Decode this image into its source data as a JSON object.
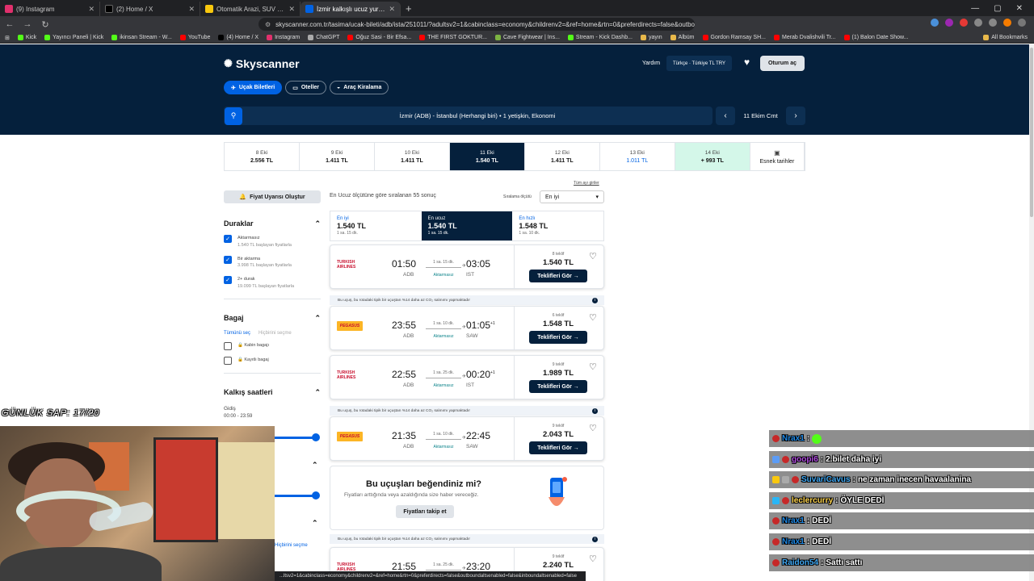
{
  "browser": {
    "tabs": [
      {
        "label": "(9) Instagram",
        "color": "#e1306c"
      },
      {
        "label": "(2) Home / X",
        "color": "#000000"
      },
      {
        "label": "Otomatik Arazi, SUV & Pickup Fiyatl...",
        "color": "#f9c80e"
      },
      {
        "label": "İzmir kalkışlı ucuz yurt içi uçuşlar",
        "color": "#0062e3",
        "active": true
      }
    ],
    "url": "skyscanner.com.tr/tasima/ucak-bileti/adb/ista/251011/?adultsv2=1&cabinclass=economy&childrenv2=&ref=home&rtn=0&preferdirects=false&outbou...",
    "bookmarks": [
      "Kick",
      "Yayıncı Paneli | Kick",
      "ikinsan Stream - W...",
      "YouTube",
      "(4) Home / X",
      "Instagram",
      "ChatGPT",
      "Oğuz Sasi - Bir Efsa...",
      "THE FIRST GOKTUR...",
      "Cave Fightwear | Ins...",
      "Stream - Kick Dashb...",
      "yayın",
      "Albüm",
      "Gordon Ramsay SH...",
      "Merab Dvalishvili Tr...",
      "(1) Balon Date Show..."
    ],
    "all_bookmarks": "All Bookmarks",
    "status_url": "...ltsv2=1&cabinclass=economy&childrenv2=&ref=home&rtn=0&preferdirects=false&outboundaltsenabled=false&inboundaltsenabled=false"
  },
  "header": {
    "logo": "Skyscanner",
    "help": "Yardım",
    "locale": "Türkçe  ·  Türkiye  TL TRY",
    "login": "Oturum aç",
    "pills": [
      "Uçak Biletleri",
      "Oteller",
      "Araç Kiralama"
    ],
    "search_summary": "İzmir (ADB) - İstanbul (Herhangi biri)  •  1 yetişkin, Ekonomi",
    "date": "11 Ekim Cmt"
  },
  "dates": [
    {
      "day": "8 Eki",
      "price": "2.556 TL"
    },
    {
      "day": "9 Eki",
      "price": "1.411 TL"
    },
    {
      "day": "10 Eki",
      "price": "1.411 TL"
    },
    {
      "day": "11 Eki",
      "price": "1.540 TL",
      "selected": true
    },
    {
      "day": "12 Eki",
      "price": "1.411 TL"
    },
    {
      "day": "13 Eki",
      "price": "1.011 TL"
    },
    {
      "day": "14 Eki",
      "price": "+ 993 TL"
    }
  ],
  "flexible_dates": "Esnek tarihler",
  "filters": {
    "alert": "Fiyat Uyarısı Oluştur",
    "stops_title": "Duraklar",
    "stops": [
      {
        "label": "Aktarmasız",
        "sub": "1.540 TL başlayan fiyatlarla"
      },
      {
        "label": "Bir aktarma",
        "sub": "3.998 TL başlayan fiyatlarla"
      },
      {
        "label": "2+ durak",
        "sub": "19.099 TL başlayan fiyatlarla"
      }
    ],
    "baggage_title": "Bagaj",
    "select_all": "Tümünü seç",
    "clear_all": "Hiçbirini seçme",
    "bags": [
      "Kabin bagajı",
      "Kayıtlı bagaj"
    ],
    "times_title": "Kalkış saatleri",
    "outbound": "Gidiş",
    "outbound_range": "00:00 - 23:59",
    "clear_link": "Hiçbirini seçme"
  },
  "results": {
    "count_text": "En Ucuz ölçütüne göre sıralanan 55 sonuç",
    "sort_label": "Sıralama ölçütü",
    "sort_value": "En iyi",
    "all_filters": "Tüm ayı giriler",
    "tabs": [
      {
        "label": "En iyi",
        "price": "1.540 TL",
        "dur": "1 sa. 15 dk."
      },
      {
        "label": "En ucuz",
        "price": "1.540 TL",
        "dur": "1 sa. 15 dk."
      },
      {
        "label": "En hızlı",
        "price": "1.548 TL",
        "dur": "1 sa. 10 dk."
      }
    ],
    "eco_note": "Bu uçuş, bu rotadaki tipik bir uçuştan %14 daha az CO₂ salınımı yapmaktadır",
    "go_label": "Teklifleri Gör →",
    "cards": [
      {
        "airline": "TURKISH AIRLINES",
        "dep": "01:50",
        "depc": "ADB",
        "dur": "1 sa. 15 dk.",
        "stop": "Aktarmasız",
        "arr": "03:05",
        "plus": "",
        "arrc": "IST",
        "offers": "8 teklif",
        "price": "1.540 TL"
      },
      {
        "airline": "PEGASUS",
        "dep": "23:55",
        "depc": "ADB",
        "dur": "1 sa. 10 dk.",
        "stop": "Aktarmasız",
        "arr": "01:05",
        "plus": "+1",
        "arrc": "SAW",
        "offers": "6 teklif",
        "price": "1.548 TL"
      },
      {
        "airline": "TURKISH AIRLINES",
        "dep": "22:55",
        "depc": "ADB",
        "dur": "1 sa. 25 dk.",
        "stop": "Aktarmasız",
        "arr": "00:20",
        "plus": "+1",
        "arrc": "IST",
        "offers": "9 teklif",
        "price": "1.989 TL"
      },
      {
        "airline": "PEGASUS",
        "dep": "21:35",
        "depc": "ADB",
        "dur": "1 sa. 10 dk.",
        "stop": "Aktarmasız",
        "arr": "22:45",
        "plus": "",
        "arrc": "SAW",
        "offers": "9 teklif",
        "price": "2.043 TL"
      },
      {
        "airline": "TURKISH AIRLINES",
        "dep": "21:55",
        "depc": "",
        "dur": "1 sa. 25 dk.",
        "stop": "",
        "arr": "23:20",
        "plus": "",
        "arrc": "",
        "offers": "9 teklif",
        "price": "2.240 TL"
      }
    ],
    "promo": {
      "title": "Bu uçuşları beğendiniz mi?",
      "text": "Fiyatları arttığında veya azaldığında size haber vereceğiz.",
      "button": "Fiyatları takip et"
    }
  },
  "stream": {
    "overlay_text": "GÜNLÜK SAP: 17/20",
    "chat": [
      {
        "user": "Nrax1",
        "msg": "",
        "color": "#1e88e5",
        "emote": true
      },
      {
        "user": "goopi6",
        "msg": "2.bilet daha iyi",
        "color": "#b04ae0"
      },
      {
        "user": "SuvariCavus",
        "msg": "ne zaman inecen havaalanina",
        "color": "#3fa9f5"
      },
      {
        "user": "leclercurry",
        "msg": "ÖYLE DEDİ",
        "color": "#ffd54f"
      },
      {
        "user": "Nrax1",
        "msg": "DEDİ",
        "color": "#1e88e5"
      },
      {
        "user": "Nrax1",
        "msg": "DEDİ",
        "color": "#1e88e5"
      },
      {
        "user": "Raidon54",
        "msg": "Sattı sattı",
        "color": "#3fa9f5"
      }
    ]
  }
}
